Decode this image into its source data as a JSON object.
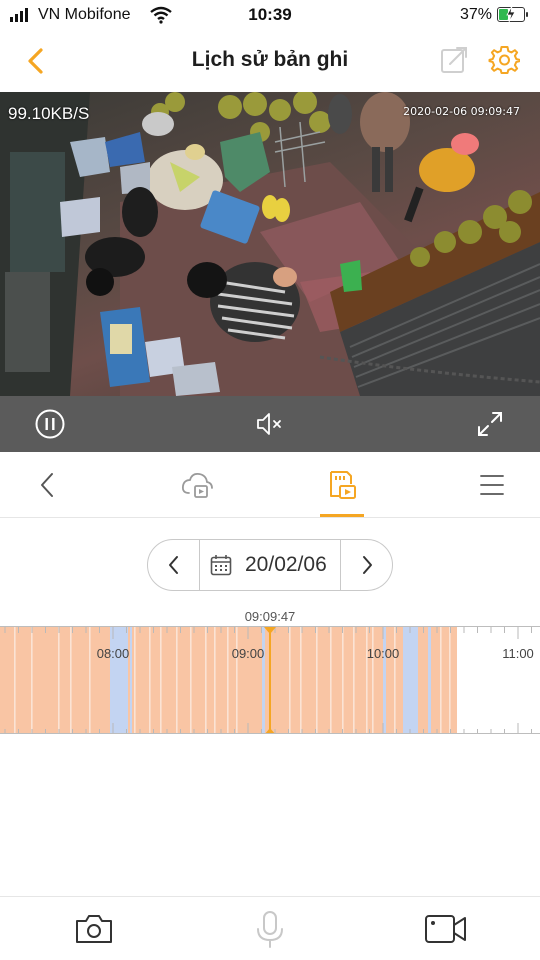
{
  "status_bar": {
    "carrier": "VN Mobifone",
    "time": "10:39",
    "battery": "37%",
    "battery_level": 0.37
  },
  "header": {
    "title": "Lịch sử bản ghi",
    "back_icon": "chevron-left-icon",
    "share_icon": "share-icon",
    "settings_icon": "gear-icon",
    "accent_color": "#f5a623"
  },
  "video": {
    "bitrate": "99.10KB/S",
    "timestamp": "2020-02-06 09:09:47"
  },
  "controls": {
    "pause_icon": "pause-icon",
    "mute_icon": "speaker-muted-icon",
    "fullscreen_icon": "fullscreen-icon"
  },
  "tabs": [
    {
      "icon": "chevron-left-icon",
      "active": false
    },
    {
      "icon": "cloud-playback-icon",
      "active": false
    },
    {
      "icon": "sd-card-playback-icon",
      "active": true
    },
    {
      "icon": "menu-icon",
      "active": false
    }
  ],
  "date_picker": {
    "date": "20/02/06"
  },
  "timeline": {
    "cursor_time": "09:09:47",
    "hour_labels": [
      "08:00",
      "09:00",
      "10:00",
      "11:00"
    ],
    "recording_color": "#f9c5a4",
    "motion_color": "#c3d4f2",
    "cursor_color": "#f5a623"
  },
  "bottom_bar": {
    "snapshot_icon": "camera-icon",
    "mic_icon": "microphone-icon",
    "record_icon": "video-record-icon"
  }
}
